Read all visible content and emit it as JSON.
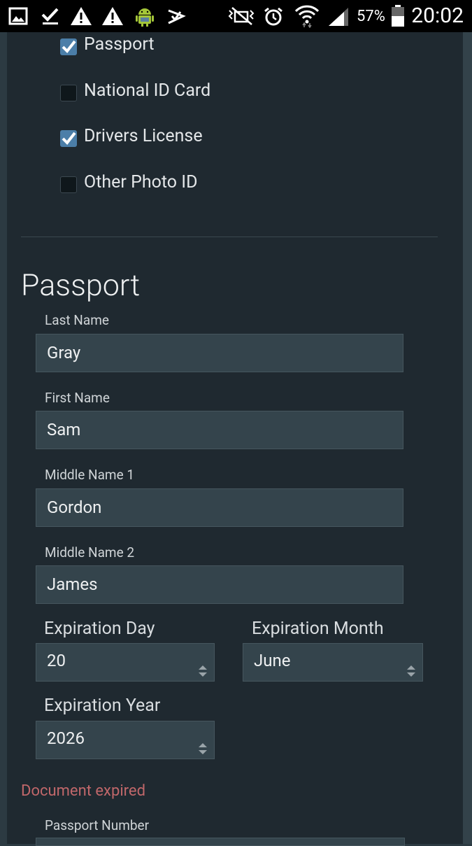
{
  "status_bar": {
    "battery_percent": "57%",
    "time": "20:02",
    "icons": [
      "gallery-icon",
      "task-check-icon",
      "warning-icon",
      "warning-icon",
      "android-icon",
      "checklist-icon",
      "mute-icon",
      "alarm-icon",
      "wifi-icon",
      "signal-icon",
      "battery-icon"
    ]
  },
  "document_types": [
    {
      "label": "Passport",
      "checked": true
    },
    {
      "label": "National ID Card",
      "checked": false
    },
    {
      "label": "Drivers License",
      "checked": true
    },
    {
      "label": "Other Photo ID",
      "checked": false
    }
  ],
  "passport": {
    "section_title": "Passport",
    "last_name": {
      "label": "Last Name",
      "value": "Gray"
    },
    "first_name": {
      "label": "First Name",
      "value": "Sam"
    },
    "middle_name_1": {
      "label": "Middle Name 1",
      "value": "Gordon"
    },
    "middle_name_2": {
      "label": "Middle Name 2",
      "value": "James"
    },
    "expiration_day": {
      "label": "Expiration Day",
      "value": "20"
    },
    "expiration_month": {
      "label": "Expiration Month",
      "value": "June"
    },
    "expiration_year": {
      "label": "Expiration Year",
      "value": "2026"
    },
    "error": "Document expired",
    "passport_number": {
      "label": "Passport Number"
    }
  },
  "colors": {
    "panel_bg": "#1f2930",
    "field_bg": "#34444c",
    "checkbox_on": "#4b7ea8",
    "error_text": "#c0676a"
  }
}
